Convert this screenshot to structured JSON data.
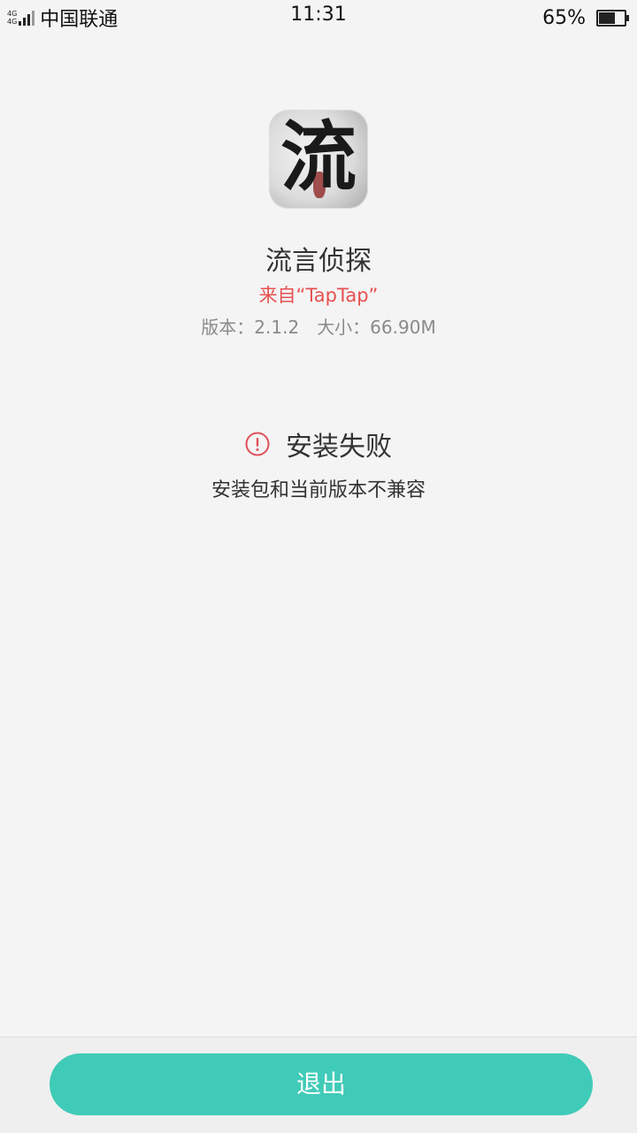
{
  "status_bar": {
    "network_top": "4G",
    "network_bottom": "4G",
    "carrier": "中国联通",
    "time": "11:31",
    "battery_percent_text": "65%",
    "battery_level": 0.65
  },
  "app": {
    "icon_glyph": "流",
    "name": "流言侦探",
    "source": "来自“TapTap”",
    "version": "版本：2.1.2",
    "size": "大小：66.90M"
  },
  "result": {
    "title": "安装失败",
    "description": "安装包和当前版本不兼容",
    "icon": "alert-circle-icon",
    "icon_color": "#e0505a"
  },
  "footer": {
    "exit_label": "退出",
    "button_color": "#40cbb8"
  }
}
